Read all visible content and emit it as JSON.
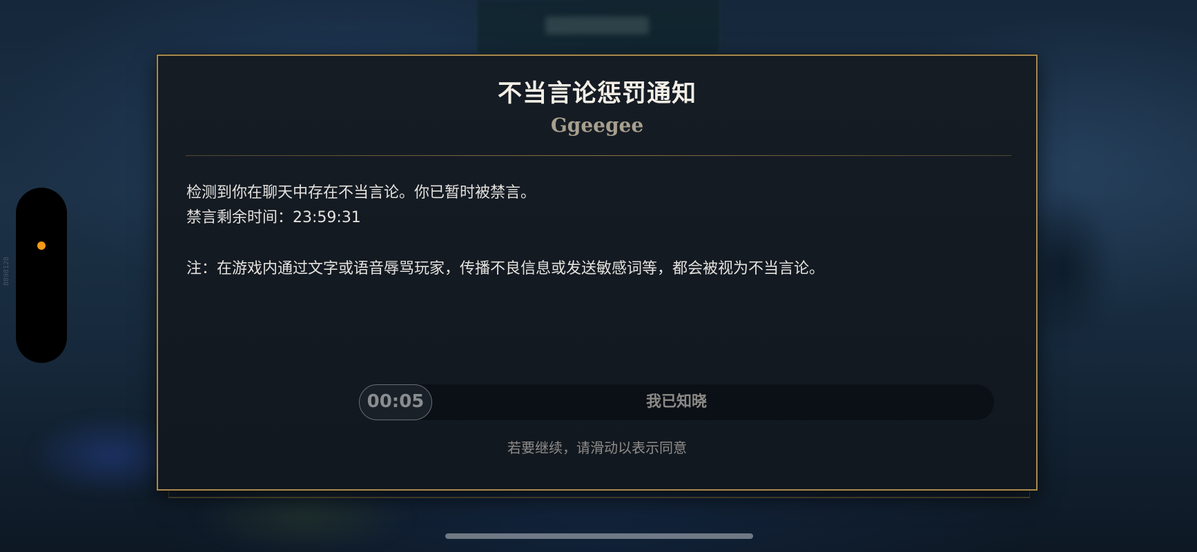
{
  "modal": {
    "title": "不当言论惩罚通知",
    "player_name": "Ggeegee",
    "message_line1": "检测到你在聊天中存在不当言论。你已暂时被禁言。",
    "mute_remaining": "禁言剩余时间：23:59:31",
    "note": "注：在游戏内通过文字或语音辱骂玩家，传播不良信息或发送敏感词等，都会被视为不当言论。",
    "slider": {
      "countdown": "00:05",
      "label": "我已知晓",
      "progress": 0
    },
    "hint": "若要继续，请滑动以表示同意"
  },
  "side_handle": {
    "tag": "8898128",
    "indicator_color": "#f29a1a"
  },
  "colors": {
    "border_gold": "#a88a4f",
    "panel_bg": "#161c24",
    "title_text": "#f3efe6"
  }
}
